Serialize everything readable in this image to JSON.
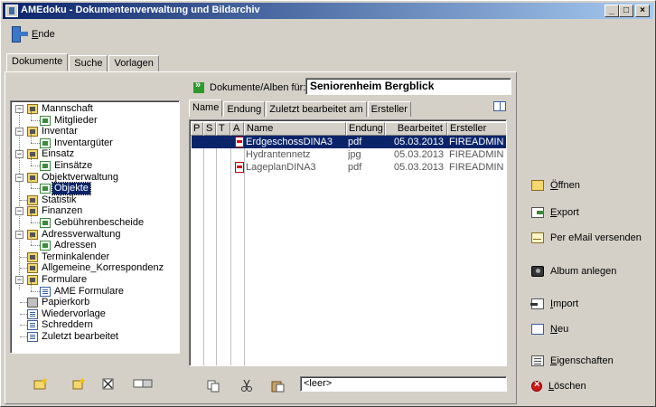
{
  "window": {
    "title": "AMEdoku - Dokumentenverwaltung und Bildarchiv",
    "min_label": "_",
    "max_label": "□",
    "close_label": "×"
  },
  "menu": {
    "ende_underlined": "E",
    "ende_rest": "nde"
  },
  "top_tabs": [
    {
      "label": "Dokumente",
      "active": true
    },
    {
      "label": "Suche",
      "active": false
    },
    {
      "label": "Vorlagen",
      "active": false
    }
  ],
  "tree": {
    "collapse_glyph": "−",
    "items": [
      {
        "label": "Mannschaft",
        "level": 0,
        "icon": "folder-icon"
      },
      {
        "label": "Mitglieder",
        "level": 1,
        "icon": "child-icon"
      },
      {
        "label": "Inventar",
        "level": 0,
        "icon": "folder-icon"
      },
      {
        "label": "Inventargüter",
        "level": 1,
        "icon": "child-icon"
      },
      {
        "label": "Einsatz",
        "level": 0,
        "icon": "folder-icon"
      },
      {
        "label": "Einsätze",
        "level": 1,
        "icon": "child-icon"
      },
      {
        "label": "Objektverwaltung",
        "level": 0,
        "icon": "folder-icon"
      },
      {
        "label": "Objekte",
        "level": 1,
        "icon": "child-icon",
        "selected": true
      },
      {
        "label": "Statistik",
        "level": 0,
        "icon": "folder-icon"
      },
      {
        "label": "Finanzen",
        "level": 0,
        "icon": "folder-icon"
      },
      {
        "label": "Gebührenbescheide",
        "level": 1,
        "icon": "child-icon"
      },
      {
        "label": "Adressverwaltung",
        "level": 0,
        "icon": "folder-icon"
      },
      {
        "label": "Adressen",
        "level": 1,
        "icon": "child-icon"
      },
      {
        "label": "Terminkalender",
        "level": 0,
        "icon": "folder-icon"
      },
      {
        "label": "Allgemeine_Korrespondenz",
        "level": 0,
        "icon": "folder-icon"
      },
      {
        "label": "Formulare",
        "level": 0,
        "icon": "folder-icon"
      },
      {
        "label": "AME Formulare",
        "level": 1,
        "icon": "page-icon"
      },
      {
        "label": "Papierkorb",
        "level": 0,
        "icon": "trash-icon"
      },
      {
        "label": "Wiedervorlage",
        "level": 0,
        "icon": "page-icon"
      },
      {
        "label": "Schreddern",
        "level": 0,
        "icon": "page-icon"
      },
      {
        "label": "Zuletzt bearbeitet",
        "level": 0,
        "icon": "page-icon"
      }
    ]
  },
  "dokalben": {
    "label": "Dokumente/Alben für:",
    "value": "Seniorenheim Bergblick"
  },
  "list_tabs": [
    {
      "label": "Name",
      "active": true
    },
    {
      "label": "Endung",
      "active": false
    },
    {
      "label": "Zuletzt bearbeitet am",
      "active": false
    },
    {
      "label": "Ersteller",
      "active": false
    }
  ],
  "columns": {
    "p": "P",
    "s": "S",
    "t": "T",
    "a": "A",
    "name": "Name",
    "endung": "Endung",
    "bearbeitet": "Bearbeitet",
    "ersteller": "Ersteller"
  },
  "files": [
    {
      "name": "ErdgeschossDINA3",
      "ext": "pdf",
      "date": "05.03.2013",
      "creator": "FIREADMIN",
      "selected": true
    },
    {
      "name": "Hydrantennetz",
      "ext": "jpg",
      "date": "05.03.2013",
      "creator": "FIREADMIN",
      "selected": false
    },
    {
      "name": "LageplanDINA3",
      "ext": "pdf",
      "date": "05.03.2013",
      "creator": "FIREADMIN",
      "selected": false
    }
  ],
  "filter": {
    "value": "<leer>"
  },
  "actions": {
    "oeffnen": {
      "u": "Ö",
      "rest": "ffnen"
    },
    "export": {
      "u": "E",
      "rest": "xport"
    },
    "email": {
      "label": "Per eMail versenden"
    },
    "album": {
      "label": "Album anlegen"
    },
    "import": {
      "u": "I",
      "rest": "mport"
    },
    "neu": {
      "u": "N",
      "rest": "eu"
    },
    "eigenschaften": {
      "u": "E",
      "rest": "igenschaften"
    },
    "loeschen": {
      "u": "L",
      "rest": "öschen"
    }
  }
}
